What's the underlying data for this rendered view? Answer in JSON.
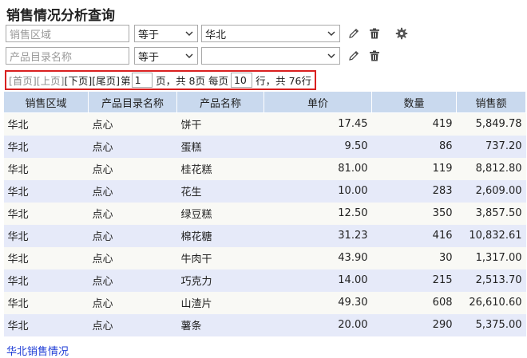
{
  "title": "销售情况分析查询",
  "filters": [
    {
      "field_placeholder": "销售区域",
      "operator": "等于",
      "value": "华北"
    },
    {
      "field_placeholder": "产品目录名称",
      "operator": "等于",
      "value": ""
    }
  ],
  "icons": {
    "edit": "pencil-icon",
    "delete": "trash-icon",
    "settings": "gear-icon",
    "dropdown": "chevron-down-icon"
  },
  "pager": {
    "first": "[首页]",
    "prev": "[上页]",
    "next": "[下页]",
    "last": "[尾页]",
    "page_prefix": "第",
    "page_value": "1",
    "page_suffix": "页，共 8页 每页",
    "size_value": "10",
    "size_suffix": "行，共 76行"
  },
  "table": {
    "columns": [
      "销售区域",
      "产品目录名称",
      "产品名称",
      "单价",
      "数量",
      "销售额"
    ],
    "rows": [
      [
        "华北",
        "点心",
        "饼干",
        "17.45",
        "419",
        "5,849.78"
      ],
      [
        "华北",
        "点心",
        "蛋糕",
        "9.50",
        "86",
        "737.20"
      ],
      [
        "华北",
        "点心",
        "桂花糕",
        "81.00",
        "119",
        "8,812.80"
      ],
      [
        "华北",
        "点心",
        "花生",
        "10.00",
        "283",
        "2,609.00"
      ],
      [
        "华北",
        "点心",
        "绿豆糕",
        "12.50",
        "350",
        "3,857.50"
      ],
      [
        "华北",
        "点心",
        "棉花糖",
        "31.23",
        "416",
        "10,832.61"
      ],
      [
        "华北",
        "点心",
        "牛肉干",
        "43.90",
        "30",
        "1,317.00"
      ],
      [
        "华北",
        "点心",
        "巧克力",
        "14.00",
        "215",
        "2,513.70"
      ],
      [
        "华北",
        "点心",
        "山渣片",
        "49.30",
        "608",
        "26,610.60"
      ],
      [
        "华北",
        "点心",
        "薯条",
        "20.00",
        "290",
        "5,375.00"
      ]
    ]
  },
  "footer_link": "华北销售情况",
  "colors": {
    "header_bg": "#c9d9ee",
    "row_odd": "#f9f9f5",
    "row_even": "#e6eaf9",
    "link": "#1f3dd6",
    "highlight_border": "#d92020"
  }
}
